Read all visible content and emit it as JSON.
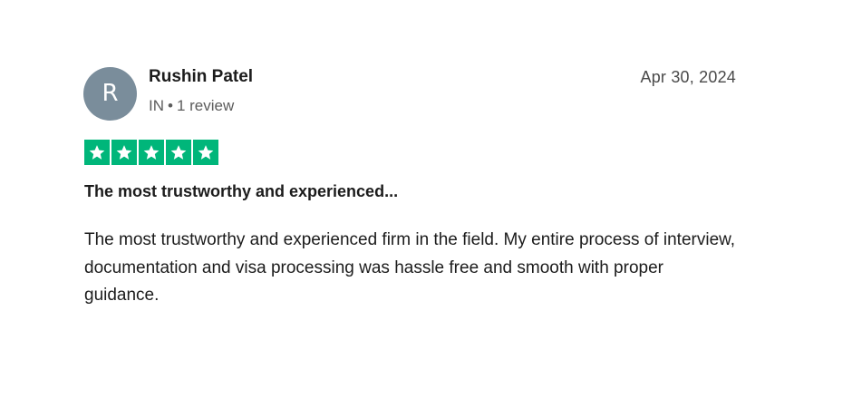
{
  "reviewer": {
    "initial": "R",
    "name": "Rushin Patel",
    "country": "IN",
    "review_count": "1 review"
  },
  "review": {
    "date": "Apr 30, 2024",
    "rating": 5,
    "rating_max": 5,
    "title": "The most trustworthy and experienced...",
    "body": "The most trustworthy and experienced firm in the field. My entire process of interview, documentation and visa processing was hassle free and smooth with proper guidance."
  },
  "colors": {
    "star_background": "#00b67a",
    "avatar_background": "#7a8d9b"
  },
  "icons": {
    "star": "star-icon"
  }
}
